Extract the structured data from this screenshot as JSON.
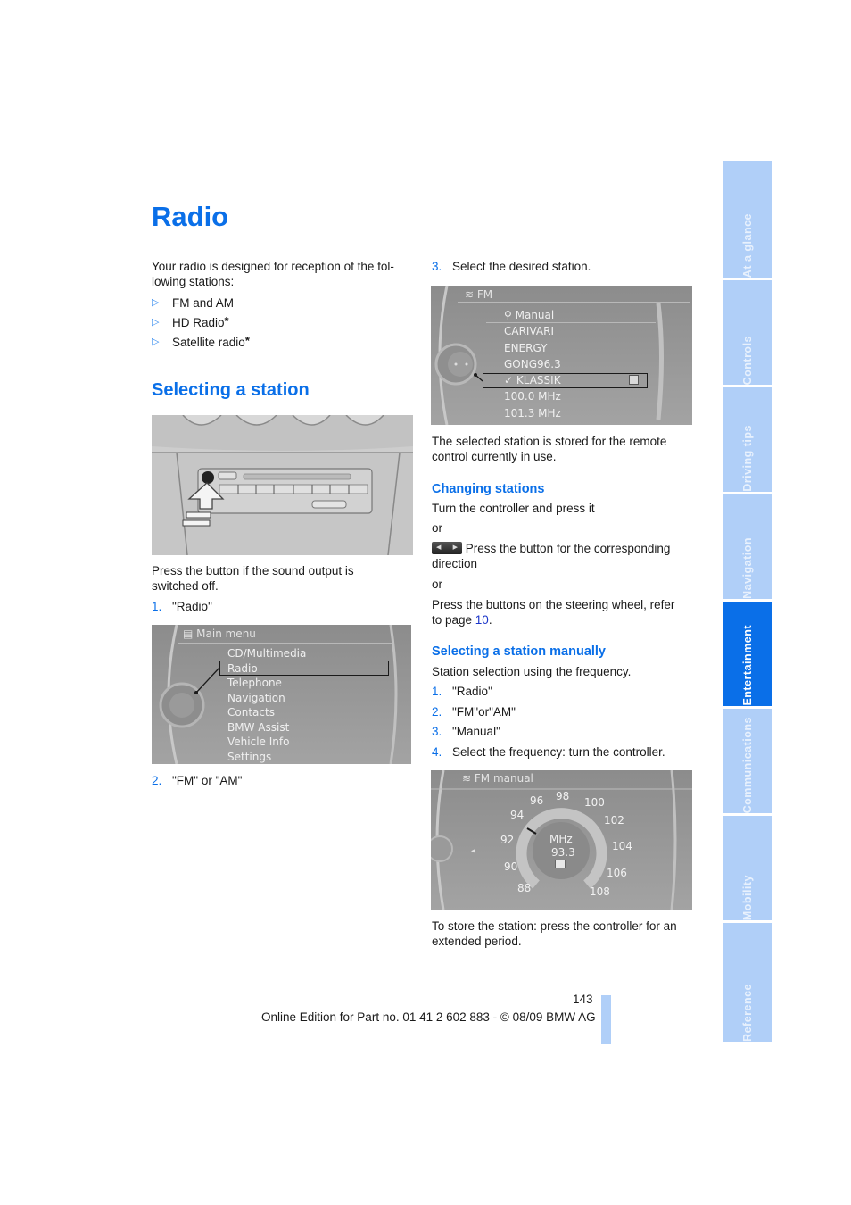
{
  "page": {
    "title": "Radio",
    "intro": "Your radio is designed for reception of the fol-lowing stations:",
    "intro_line1": "Your radio is designed for reception of the fol-",
    "intro_line2": "lowing stations:",
    "stations": [
      {
        "label": "FM and AM",
        "optional": false
      },
      {
        "label": "HD Radio",
        "optional": true
      },
      {
        "label": "Satellite radio",
        "optional": true
      }
    ],
    "bullet_glyph": "▷",
    "optional_marker": "*"
  },
  "selecting": {
    "heading": "Selecting a station",
    "caption_line1": "Press the button if the sound output is",
    "caption_line2": "switched off.",
    "steps": [
      {
        "n": "1.",
        "text": "\"Radio\""
      },
      {
        "n": "2.",
        "text": "\"FM\" or \"AM\""
      },
      {
        "n": "3.",
        "text": "Select the desired station."
      }
    ],
    "main_menu": {
      "header": "Main menu",
      "items": [
        "CD/Multimedia",
        "Radio",
        "Telephone",
        "Navigation",
        "Contacts",
        "BMW Assist",
        "Vehicle Info",
        "Settings"
      ],
      "selected": "Radio"
    },
    "fm_menu": {
      "header": "FM",
      "items": [
        "Manual",
        "CARIVARI",
        "ENERGY",
        "GONG96.3",
        "KLASSIK",
        "100.0 MHz",
        "101.3 MHz"
      ],
      "selected": "KLASSIK",
      "check": "✓"
    },
    "stored_note_line1": "The selected station is stored for the remote",
    "stored_note_line2": "control currently in use."
  },
  "changing": {
    "heading": "Changing stations",
    "line1": "Turn the controller and press it",
    "or1": "or",
    "button_text_line1": "Press the button for the corresponding",
    "button_text_line2": "direction",
    "or2": "or",
    "steering_line1": "Press the buttons on the steering wheel, refer",
    "steering_line2_prefix": "to page ",
    "steering_page_link": "10",
    "steering_line2_suffix": "."
  },
  "manual": {
    "heading": "Selecting a station manually",
    "intro": "Station selection using the frequency.",
    "steps": [
      {
        "n": "1.",
        "text": "\"Radio\""
      },
      {
        "n": "2.",
        "text": "\"FM\"or\"AM\""
      },
      {
        "n": "3.",
        "text": "\"Manual\""
      },
      {
        "n": "4.",
        "text": "Select the frequency: turn the controller."
      }
    ],
    "fm_manual_screen": {
      "header": "FM manual",
      "unit": "MHz",
      "frequency": "93.3",
      "scale": [
        "88",
        "90",
        "92",
        "94",
        "96",
        "98",
        "100",
        "102",
        "104",
        "106",
        "108"
      ]
    },
    "store_note_line1": "To store the station: press the controller for an",
    "store_note_line2": "extended period."
  },
  "footer": {
    "page_number": "143",
    "edition": "Online Edition for Part no. 01 41 2 602 883 - © 08/09 BMW AG"
  },
  "side_tabs": [
    {
      "label": "At a glance",
      "active": false
    },
    {
      "label": "Controls",
      "active": false
    },
    {
      "label": "Driving tips",
      "active": false
    },
    {
      "label": "Navigation",
      "active": false
    },
    {
      "label": "Entertainment",
      "active": true
    },
    {
      "label": "Communications",
      "active": false
    },
    {
      "label": "Mobility",
      "active": false
    },
    {
      "label": "Reference",
      "active": false
    }
  ],
  "colors": {
    "accent": "#0a6fe8",
    "tab_inactive": "#b0cff8",
    "link": "#1a35c9"
  }
}
